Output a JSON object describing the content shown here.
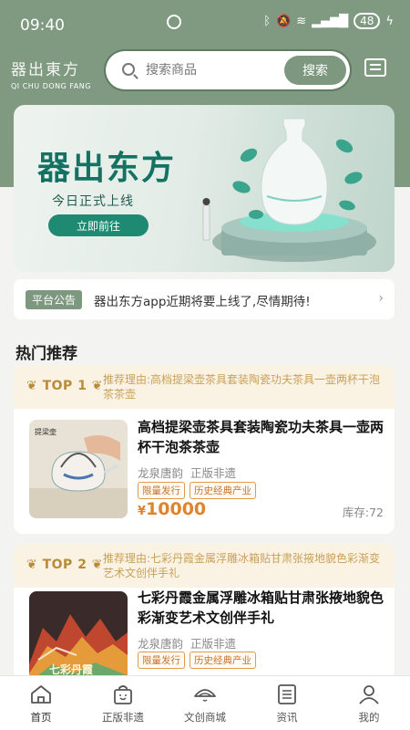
{
  "status": {
    "time": "09:40",
    "battery": "48"
  },
  "brand": {
    "logo_cn": "器出東方",
    "logo_en": "QI CHU DONG FANG"
  },
  "search": {
    "placeholder": "搜索商品",
    "button": "搜索"
  },
  "banner": {
    "title": "器出东方",
    "subtitle": "今日正式上线",
    "cta": "立即前往"
  },
  "notice": {
    "tag": "平台公告",
    "text": "器出东方app近期将要上线了,尽情期待!"
  },
  "section": {
    "title": "热门推荐"
  },
  "products": [
    {
      "rank": "TOP 1",
      "reason": "推荐理由:高档提梁壶茶具套装陶瓷功夫茶具一壶两杯干泡茶茶壶",
      "name": "高档提梁壶茶具套装陶瓷功夫茶具一壶两杯干泡茶茶壶",
      "shop": "龙泉唐韵",
      "authentic": "正版非遗",
      "tags": [
        "限量发行",
        "历史经典产业"
      ],
      "currency": "¥",
      "price": "10000",
      "stock": "库存:72",
      "thumb_caption": "提梁壶"
    },
    {
      "rank": "TOP 2",
      "reason": "推荐理由:七彩丹霞金属浮雕冰箱贴甘肃张掖地貌色彩渐变艺术文创伴手礼",
      "name": "七彩丹霞金属浮雕冰箱贴甘肃张掖地貌色彩渐变艺术文创伴手礼",
      "shop": "龙泉唐韵",
      "authentic": "正版非遗",
      "tags": [
        "限量发行",
        "历史经典产业"
      ],
      "thumb_caption": "七彩丹霞"
    }
  ],
  "tabbar": [
    {
      "label": "首页",
      "icon": "home-icon"
    },
    {
      "label": "正版非遗",
      "icon": "bag-icon"
    },
    {
      "label": "文创商城",
      "icon": "hat-icon"
    },
    {
      "label": "资讯",
      "icon": "list-icon"
    },
    {
      "label": "我的",
      "icon": "user-icon"
    }
  ],
  "colors": {
    "primary": "#7f9a80",
    "accent": "#e0832b",
    "banner_text": "#137261"
  }
}
